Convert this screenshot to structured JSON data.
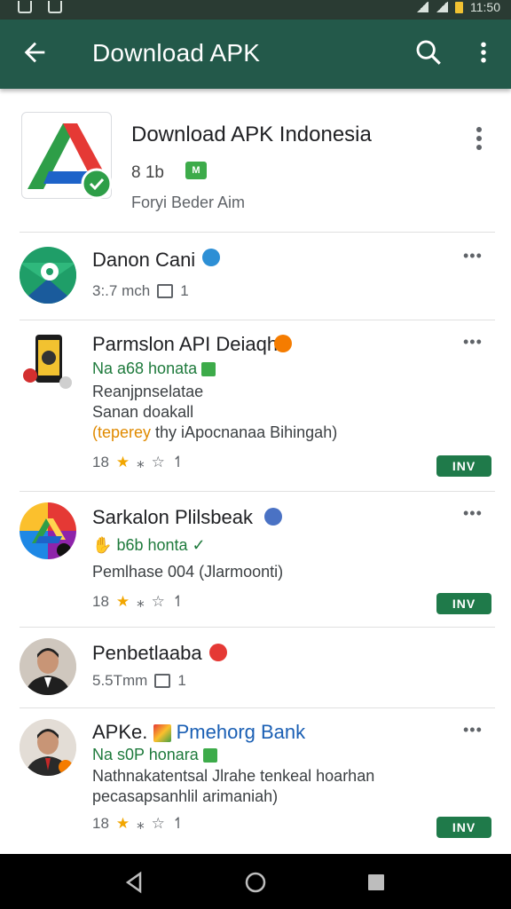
{
  "status_bar": {
    "time": "11:50"
  },
  "app_bar": {
    "title": "Download APK"
  },
  "featured": {
    "name": "Download APK Indonesia",
    "size": "8 1b",
    "badge": "M",
    "developer": "Foryi Beder Aim"
  },
  "apps": [
    {
      "name": "Danon Cani",
      "meta_size": "3:.7 mch",
      "meta_count": "1"
    },
    {
      "name": "Parmslon API Deiaqh",
      "line1": "Na a68 honata",
      "line2": "Reanjpnselatae",
      "line3": "Sanan doakall",
      "line4_orange": "(teperey",
      "line4_rest": " thy iApocnanaa Bihingah)",
      "rating": "18",
      "install": "INV"
    },
    {
      "name": "Sarkalon Plilsbeak",
      "line1": "b6b honta",
      "line2": "Pemlhase 004 (Jlarmoonti)",
      "rating": "18",
      "install": "INV"
    },
    {
      "name": "Penbetlaaba",
      "meta_size": "5.5Tmm",
      "meta_count": "1"
    },
    {
      "name_prefix": "APKe.",
      "name_blue": "Pmehorg Bank",
      "line1": "Na s0P honara",
      "line2": "Nathnakatentsal Jlrahe tenkeal hoarhan",
      "line3": "pecasapsanhlil arimaniah)",
      "rating": "18",
      "install": "INV"
    }
  ],
  "colors": {
    "app_bar": "#23594a",
    "install": "#1f7a4a",
    "star": "#f2a600"
  }
}
